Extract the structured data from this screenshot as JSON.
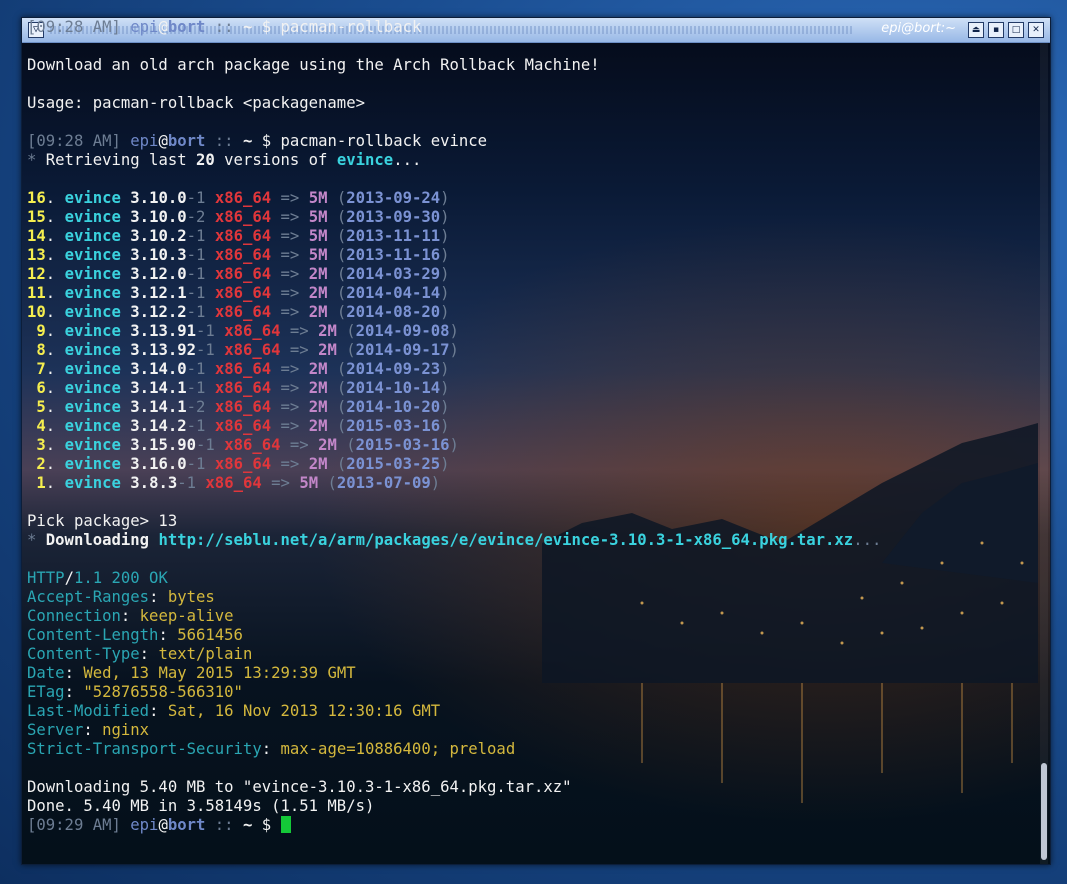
{
  "window": {
    "title": "epi@bort:~",
    "menu_icon": "menu-triangle-icon",
    "buttons": [
      "shade-icon",
      "minimize-icon",
      "maximize-icon",
      "close-icon"
    ],
    "button_glyphs": {
      "shade": "⏏",
      "minimize": "▪",
      "maximize": "□",
      "close": "✕"
    }
  },
  "prompt": {
    "open": "[",
    "close": "]",
    "user": "epi",
    "at": "@",
    "host": "bort",
    "sep": "::",
    "tilde": "~",
    "dollar": "$"
  },
  "session": {
    "line1": {
      "time": "09:28 AM",
      "cmd": "pacman-rollback"
    },
    "intro": "Download an old arch package using the Arch Rollback Machine!",
    "usage": "Usage: pacman-rollback <packagename>",
    "line2": {
      "time": "09:28 AM",
      "cmd": "pacman-rollback evince"
    },
    "retrieve": {
      "star": "*",
      "pre": "Retrieving last",
      "count": "20",
      "mid": "versions of",
      "pkg": "evince",
      "dots": "..."
    },
    "versions": [
      {
        "n": "16",
        "v": "3.10.0",
        "rel": "-1",
        "date": "2013-09-24",
        "size": "5M"
      },
      {
        "n": "15",
        "v": "3.10.0",
        "rel": "-2",
        "date": "2013-09-30",
        "size": "5M"
      },
      {
        "n": "14",
        "v": "3.10.2",
        "rel": "-1",
        "date": "2013-11-11",
        "size": "5M"
      },
      {
        "n": "13",
        "v": "3.10.3",
        "rel": "-1",
        "date": "2013-11-16",
        "size": "5M"
      },
      {
        "n": "12",
        "v": "3.12.0",
        "rel": "-1",
        "date": "2014-03-29",
        "size": "2M"
      },
      {
        "n": "11",
        "v": "3.12.1",
        "rel": "-1",
        "date": "2014-04-14",
        "size": "2M"
      },
      {
        "n": "10",
        "v": "3.12.2",
        "rel": "-1",
        "date": "2014-08-20",
        "size": "2M"
      },
      {
        "n": " 9",
        "v": "3.13.91",
        "rel": "-1",
        "date": "2014-09-08",
        "size": "2M"
      },
      {
        "n": " 8",
        "v": "3.13.92",
        "rel": "-1",
        "date": "2014-09-17",
        "size": "2M"
      },
      {
        "n": " 7",
        "v": "3.14.0",
        "rel": "-1",
        "date": "2014-09-23",
        "size": "2M"
      },
      {
        "n": " 6",
        "v": "3.14.1",
        "rel": "-1",
        "date": "2014-10-14",
        "size": "2M"
      },
      {
        "n": " 5",
        "v": "3.14.1",
        "rel": "-2",
        "date": "2014-10-20",
        "size": "2M"
      },
      {
        "n": " 4",
        "v": "3.14.2",
        "rel": "-1",
        "date": "2015-03-16",
        "size": "2M"
      },
      {
        "n": " 3",
        "v": "3.15.90",
        "rel": "-1",
        "date": "2015-03-16",
        "size": "2M"
      },
      {
        "n": " 2",
        "v": "3.16.0",
        "rel": "-1",
        "date": "2015-03-25",
        "size": "2M"
      },
      {
        "n": " 1",
        "v": "3.8.3",
        "rel": "-1",
        "date": "2013-07-09",
        "size": "5M"
      }
    ],
    "pkgname": "evince",
    "arch": "x86_64",
    "arrow": "=>",
    "pick": "Pick package> 13",
    "download": {
      "star": "*",
      "label": "Downloading",
      "url": "http://seblu.net/a/arm/packages/e/evince/evince-3.10.3-1-x86_64.pkg.tar.xz",
      "dots": "..."
    },
    "headers": [
      {
        "k": "HTTP/1.1 200 OK",
        "v": ""
      },
      {
        "k": "Accept-Ranges",
        "v": "bytes"
      },
      {
        "k": "Connection",
        "v": "keep-alive"
      },
      {
        "k": "Content-Length",
        "v": "5661456"
      },
      {
        "k": "Content-Type",
        "v": "text/plain"
      },
      {
        "k": "Date",
        "v": "Wed, 13 May 2015 13:29:39 GMT"
      },
      {
        "k": "ETag",
        "v": "\"52876558-566310\""
      },
      {
        "k": "Last-Modified",
        "v": "Sat, 16 Nov 2013 12:30:16 GMT"
      },
      {
        "k": "Server",
        "v": "nginx"
      },
      {
        "k": "Strict-Transport-Security",
        "v": "max-age=10886400; preload"
      }
    ],
    "dl_progress": "Downloading 5.40 MB to \"evince-3.10.3-1-x86_64.pkg.tar.xz\"",
    "done": "Done. 5.40 MB in 3.58149s (1.51 MB/s)",
    "line3": {
      "time": "09:29 AM"
    }
  },
  "colors": {
    "accent": "#3ad2de",
    "cursor": "#14c838",
    "arch": "#e0363b",
    "index": "#f5ee4f"
  }
}
